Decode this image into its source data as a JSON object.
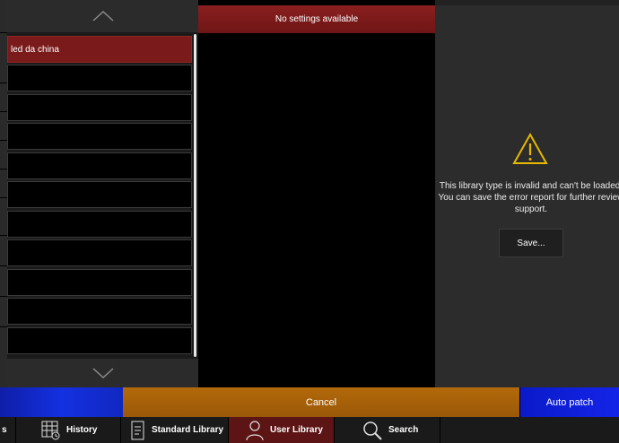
{
  "list": {
    "items": [
      "led da china",
      "",
      "",
      "",
      "",
      "",
      "",
      "",
      "",
      "",
      ""
    ],
    "selected_index": 0
  },
  "settings": {
    "header": "No settings available"
  },
  "error": {
    "message_lines": [
      "This library type is invalid and can't be loaded.",
      "You can save the error report for further review",
      "support."
    ],
    "save_label": "Save...",
    "icon": "warning-icon",
    "icon_color": "#e6b800"
  },
  "actions": {
    "cancel_label": "Cancel",
    "autopatch_label": "Auto patch"
  },
  "tabs": [
    {
      "label": "s",
      "icon": ""
    },
    {
      "label": "History",
      "icon": "history-icon"
    },
    {
      "label": "Standard Library",
      "icon": "standard-library-icon"
    },
    {
      "label": "User Library",
      "icon": "user-icon",
      "active": true
    },
    {
      "label": "Search",
      "icon": "search-icon"
    }
  ],
  "colors": {
    "selected_row": "#7a1a1a",
    "cancel": "#a65f09",
    "autopatch": "#1424e8"
  }
}
